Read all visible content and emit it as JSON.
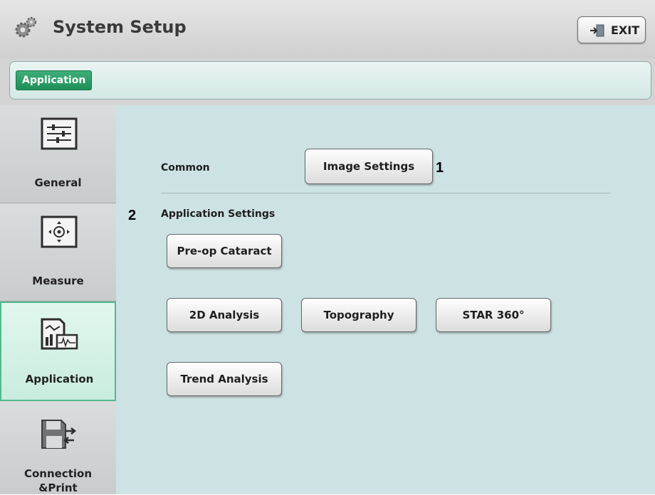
{
  "header": {
    "title": "System Setup",
    "exit_label": "EXIT"
  },
  "breadcrumb": {
    "current": "Application"
  },
  "sidebar": {
    "items": [
      {
        "label": "General",
        "icon": "sliders-icon",
        "active": false
      },
      {
        "label": "Measure",
        "icon": "target-icon",
        "active": false
      },
      {
        "label": "Application",
        "icon": "chart-icon",
        "active": true
      },
      {
        "label_line1": "Connection",
        "label_line2": "&Print",
        "icon": "save-transfer-icon",
        "active": false
      }
    ]
  },
  "main": {
    "common": {
      "label": "Common",
      "button": "Image Settings",
      "callout": "1"
    },
    "app_settings": {
      "label": "Application Settings",
      "callout": "2",
      "buttons": [
        "Pre-op Cataract",
        "2D Analysis",
        "Topography",
        "STAR 360°",
        "Trend Analysis"
      ]
    }
  },
  "colors": {
    "accent": "#1e8f57",
    "content_bg": "#cde2e3",
    "active_item": "#c9ecdd"
  }
}
